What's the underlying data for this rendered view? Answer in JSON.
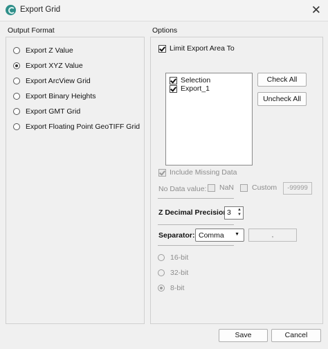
{
  "window": {
    "title": "Export Grid",
    "close_glyph": "✕"
  },
  "output_format": {
    "label": "Output Format",
    "options": [
      {
        "label": "Export Z Value",
        "checked": false
      },
      {
        "label": "Export XYZ Value",
        "checked": true
      },
      {
        "label": "Export ArcView Grid",
        "checked": false
      },
      {
        "label": "Export Binary Heights",
        "checked": false
      },
      {
        "label": "Export GMT Grid",
        "checked": false
      },
      {
        "label": "Export Floating Point GeoTIFF Grid",
        "checked": false
      }
    ]
  },
  "options": {
    "label": "Options",
    "limit_export_area": {
      "label": "Limit Export Area To",
      "checked": true
    },
    "areas": [
      {
        "label": "Selection",
        "checked": true
      },
      {
        "label": "Export_1",
        "checked": true
      }
    ],
    "check_all_label": "Check All",
    "uncheck_all_label": "Uncheck All",
    "include_missing": {
      "label": "Include Missing Data",
      "checked": true,
      "disabled": true
    },
    "no_data": {
      "label": "No Data value:",
      "nan_label": "NaN",
      "custom_label": "Custom",
      "custom_value": "-99999"
    },
    "z_precision": {
      "label": "Z Decimal Precision:",
      "value": "3"
    },
    "separator": {
      "label": "Separator:",
      "selected": "Comma",
      "preview": ","
    },
    "bit_depth": [
      {
        "label": "16-bit",
        "checked": false
      },
      {
        "label": "32-bit",
        "checked": false
      },
      {
        "label": "8-bit",
        "checked": true
      }
    ]
  },
  "footer": {
    "save_label": "Save",
    "cancel_label": "Cancel"
  }
}
